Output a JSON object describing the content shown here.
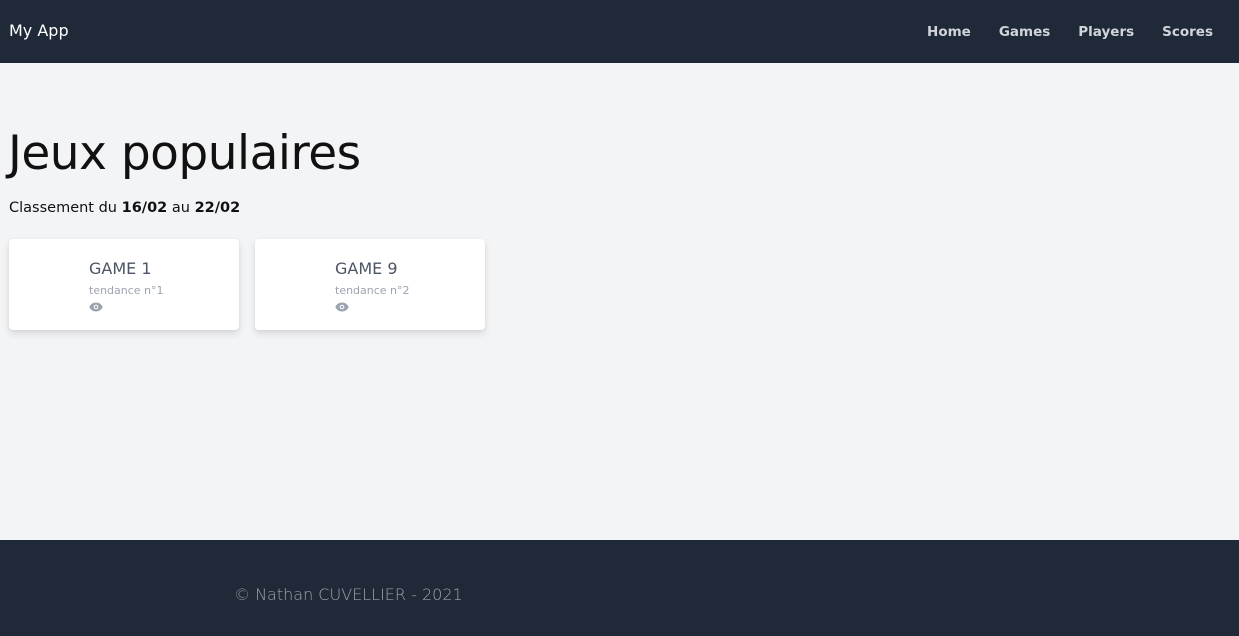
{
  "navbar": {
    "brand": "My App",
    "links": [
      {
        "label": "Home"
      },
      {
        "label": "Games"
      },
      {
        "label": "Players"
      },
      {
        "label": "Scores"
      }
    ]
  },
  "main": {
    "title": "Jeux populaires",
    "subtitle": {
      "prefix": "Classement du ",
      "start_date": "16/02",
      "middle": " au ",
      "end_date": "22/02"
    },
    "cards": [
      {
        "title": "GAME 1",
        "subtitle": "tendance n°1",
        "icon": "eye-icon"
      },
      {
        "title": "GAME 9",
        "subtitle": "tendance n°2",
        "icon": "eye-icon"
      }
    ]
  },
  "footer": {
    "text": "© Nathan CUVELLIER - 2021"
  },
  "colors": {
    "navbar_bg": "#1f2937",
    "page_bg": "#f3f4f6",
    "card_bg": "#ffffff",
    "card_title": "#4b5563",
    "muted": "#9ca3af"
  }
}
